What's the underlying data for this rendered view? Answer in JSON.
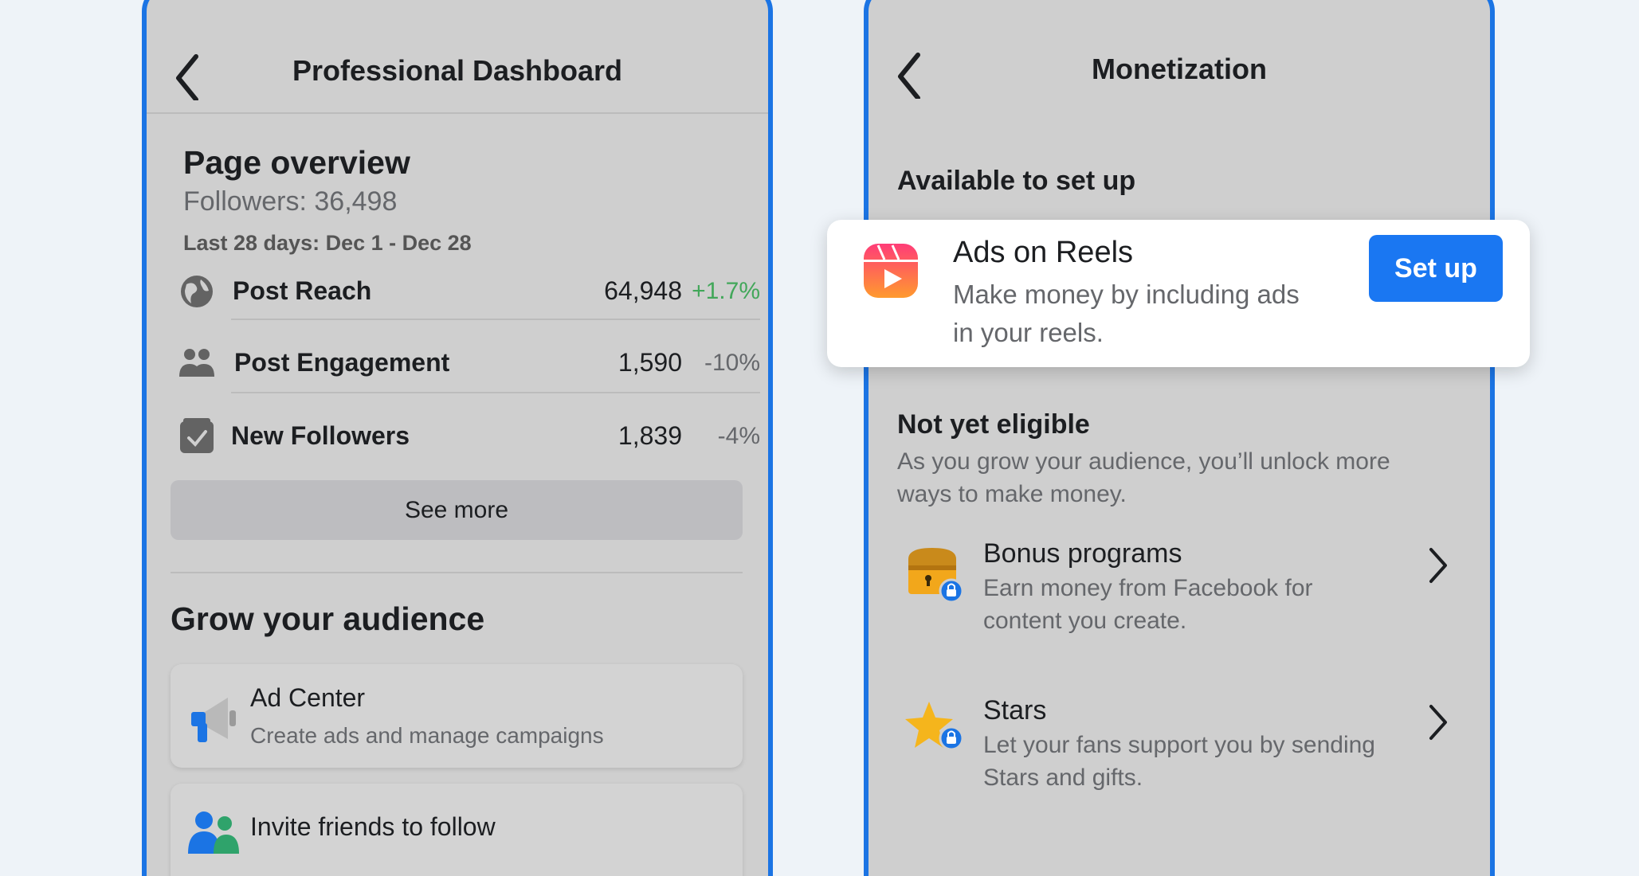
{
  "dashboard": {
    "title": "Professional Dashboard",
    "overview": {
      "heading": "Page overview",
      "followers": "Followers: 36,498",
      "date_range": "Last 28 days: Dec 1 - Dec 28"
    },
    "stats": [
      {
        "icon": "globe-icon",
        "label": "Post Reach",
        "value": "64,948",
        "change": "+1.7%"
      },
      {
        "icon": "people-icon",
        "label": "Post Engagement",
        "value": "1,590",
        "change": "-10%"
      },
      {
        "icon": "checkbox-icon",
        "label": "New Followers",
        "value": "1,839",
        "change": "-4%"
      }
    ],
    "see_more": "See more",
    "grow": {
      "heading": "Grow your audience",
      "items": [
        {
          "icon": "megaphone-icon",
          "title": "Ad Center",
          "desc": "Create ads and manage campaigns"
        },
        {
          "icon": "friends-icon",
          "title": "Invite friends to follow",
          "desc": ""
        }
      ]
    }
  },
  "monetization": {
    "title": "Monetization",
    "available_heading": "Available to set up",
    "ads_on_reels": {
      "icon": "reels-icon",
      "title": "Ads on Reels",
      "desc_line1": "Make money by including ads",
      "desc_line2": "in your reels.",
      "button": "Set up"
    },
    "not_eligible": {
      "heading": "Not yet eligible",
      "desc_line1": "As you grow your audience, you’ll unlock more",
      "desc_line2": "ways to make money."
    },
    "programs": [
      {
        "icon": "treasure-chest-icon",
        "title": "Bonus programs",
        "desc_line1": "Earn money from Facebook for",
        "desc_line2": "content you create."
      },
      {
        "icon": "star-icon",
        "title": "Stars",
        "desc_line1": "Let your fans support you by sending",
        "desc_line2": "Stars and gifts."
      }
    ]
  },
  "colors": {
    "accent": "#1b74e4",
    "button_blue": "#1a77f2",
    "positive_green": "#42a75a",
    "panel_gray": "#cfcfcf",
    "page_bg": "#eef3f8"
  }
}
